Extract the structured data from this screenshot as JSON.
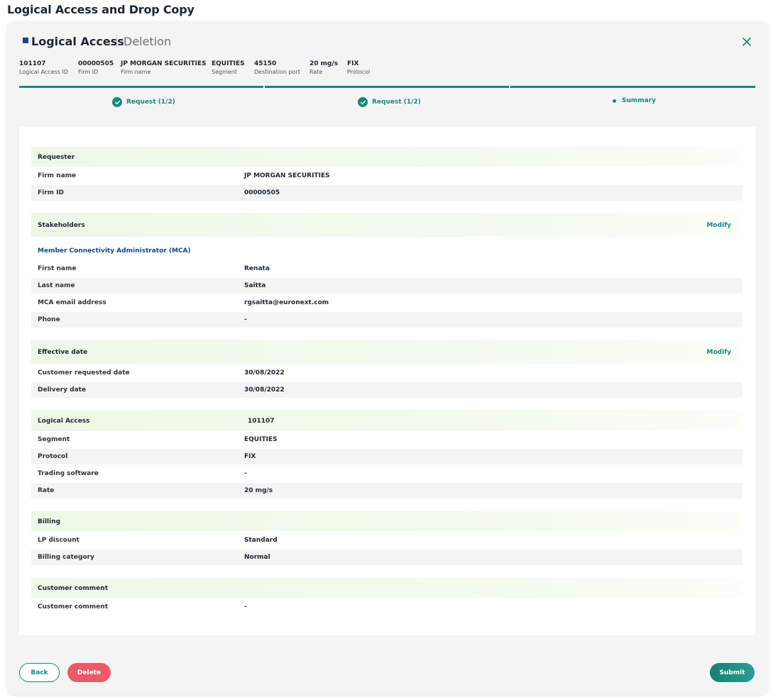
{
  "page_title": "Logical Access and Drop Copy",
  "header": {
    "title": "Logical Access",
    "subtitle": "Deletion"
  },
  "meta": [
    {
      "value": "101107",
      "label": "Logical Access ID"
    },
    {
      "value": "00000505",
      "label": "Firm ID"
    },
    {
      "value": "JP MORGAN SECURITIES",
      "label": "Firm name"
    },
    {
      "value": "EQUITIES",
      "label": "Segment"
    },
    {
      "value": "45150",
      "label": "Destination port"
    },
    {
      "value": "20 mg/s",
      "label": "Rate"
    },
    {
      "value": "FIX",
      "label": "Protocol"
    }
  ],
  "steps": [
    {
      "label": "Request (1/2)",
      "state": "done"
    },
    {
      "label": "Request (1/2)",
      "state": "done"
    },
    {
      "label": "Summary",
      "state": "current"
    }
  ],
  "sections": {
    "requester": {
      "title": "Requester",
      "rows": [
        {
          "k": "Firm name",
          "v": "JP MORGAN SECURITIES"
        },
        {
          "k": "Firm ID",
          "v": "00000505"
        }
      ]
    },
    "stakeholders": {
      "title": "Stakeholders",
      "modify": "Modify",
      "subheading": "Member Connectivity Administrator (MCA)",
      "rows": [
        {
          "k": "First name",
          "v": "Renata"
        },
        {
          "k": "Last name",
          "v": "Saitta"
        },
        {
          "k": "MCA email address",
          "v": "rgsaitta@euronext.com"
        },
        {
          "k": "Phone",
          "v": "-"
        }
      ]
    },
    "effective_date": {
      "title": "Effective date",
      "modify": "Modify",
      "rows": [
        {
          "k": "Customer requested date",
          "v": "30/08/2022"
        },
        {
          "k": "Delivery date",
          "v": "30/08/2022"
        }
      ]
    },
    "logical_access": {
      "title": "Logical Access",
      "value": "101107",
      "rows": [
        {
          "k": "Segment",
          "v": "EQUITIES"
        },
        {
          "k": "Protocol",
          "v": "FIX"
        },
        {
          "k": "Trading software",
          "v": "-"
        },
        {
          "k": "Rate",
          "v": "20 mg/s"
        }
      ]
    },
    "billing": {
      "title": "Billing",
      "rows": [
        {
          "k": "LP discount",
          "v": "Standard"
        },
        {
          "k": "Billing category",
          "v": "Normal"
        }
      ]
    },
    "customer_comment": {
      "title": "Customer comment",
      "rows": [
        {
          "k": "Customer comment",
          "v": "-"
        }
      ]
    }
  },
  "buttons": {
    "back": "Back",
    "delete": "Delete",
    "submit": "Submit"
  },
  "colors": {
    "accent": "#168a7a",
    "brand": "#0a4a8c",
    "danger": "#ea5a6b"
  },
  "icons": {
    "close": "close-icon",
    "step_done": "check-circle-icon",
    "step_current": "dot-icon"
  }
}
